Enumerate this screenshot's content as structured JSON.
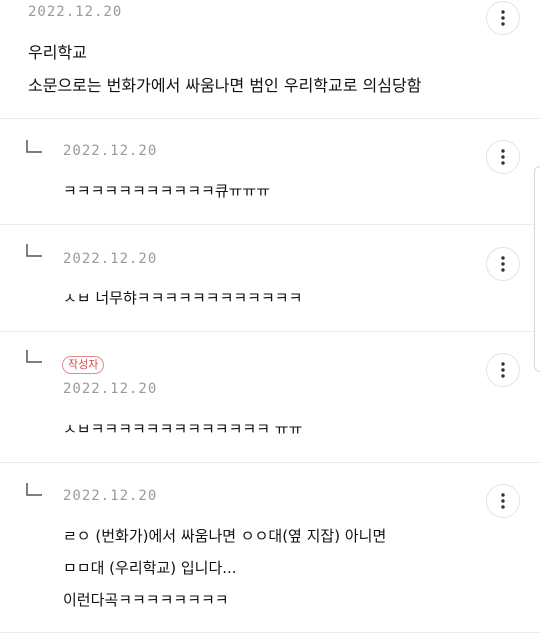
{
  "post": {
    "date": "2022.12.20",
    "title": "우리학교",
    "body": "소문으로는 번화가에서 싸움나면 범인 우리학교로 의심당함"
  },
  "comments": [
    {
      "date": "2022.12.20",
      "author_badge": "",
      "lines": [
        "ㅋㅋㅋㅋㅋㅋㅋㅋㅋㅋㅋ큐ㅠㅠㅠ"
      ]
    },
    {
      "date": "2022.12.20",
      "author_badge": "",
      "lines": [
        "ㅅㅂ 너무햐ㅋㅋㅋㅋㅋㅋㅋㅋㅋㅋㅋㅋ"
      ]
    },
    {
      "date": "2022.12.20",
      "author_badge": "작성자",
      "lines": [
        "ㅅㅂㅋㅋㅋㅋㅋㅋㅋㅋㅋㅋㅋㅋㅋ ㅠㅠ"
      ]
    },
    {
      "date": "2022.12.20",
      "author_badge": "",
      "lines": [
        "ㄹㅇ (번화가)에서 싸움나면 ㅇㅇ대(옆 지잡) 아니면",
        "ㅁㅁ대 (우리학교) 입니다...",
        "이런다곡ㅋㅋㅋㅋㅋㅋㅋㅋ"
      ]
    }
  ],
  "icons": {
    "menu": "more-vertical-icon",
    "reply": "reply-arrow-icon"
  },
  "colors": {
    "badge": "#e04a4a",
    "date": "#9a9a9a",
    "divider": "#ececec"
  }
}
